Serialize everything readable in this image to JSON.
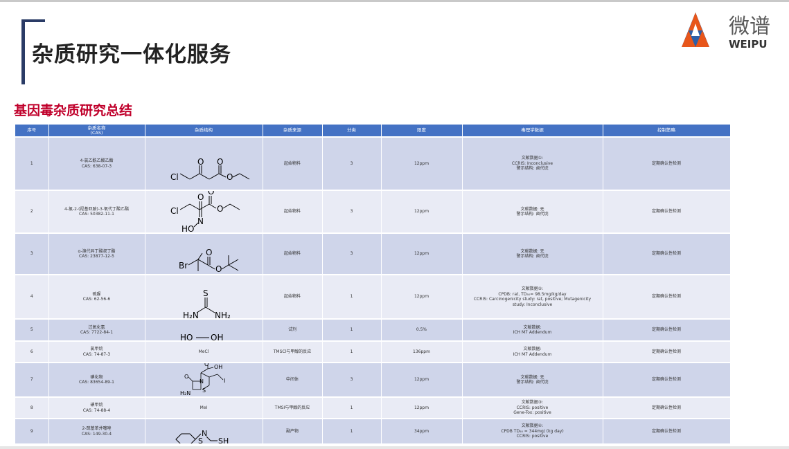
{
  "header": {
    "title": "杂质研究一体化服务"
  },
  "logo": {
    "name_cn": "微谱",
    "name_en": "WEIPU",
    "colors": {
      "blue": "#2d5fa8",
      "orange": "#e8561a"
    }
  },
  "section": {
    "title": "基因毒杂质研究总结"
  },
  "table": {
    "headers": [
      "序号",
      "杂质名称\n(CAS)",
      "杂质结构",
      "杂质来源",
      "分类",
      "限度",
      "毒理学数据",
      "控制策略"
    ],
    "rows": [
      {
        "no": "1",
        "name": "4-氯乙酰乙酸乙酯",
        "cas": "CAS: 638-07-3",
        "source": "起始物料",
        "class": "3",
        "limit": "12ppm",
        "tox": [
          "文献数据①:",
          "CCRIS: Inconclusive",
          "警示结构: 卤代烷"
        ],
        "control": "定期确认性检测"
      },
      {
        "no": "2",
        "name": "4-氯-2-(羟基亚胺)-3-氧代丁酸乙酯",
        "cas": "CAS: 50382-11-1",
        "source": "起始物料",
        "class": "3",
        "limit": "12ppm",
        "tox": [
          "文献数据: 无",
          "警示结构: 卤代烷"
        ],
        "control": "定期确认性检测"
      },
      {
        "no": "3",
        "name": "α-溴代异丁酸叔丁酯",
        "cas": "CAS: 23877-12-5",
        "source": "起始物料",
        "class": "3",
        "limit": "12ppm",
        "tox": [
          "文献数据: 无",
          "警示结构: 卤代烷"
        ],
        "control": "定期确认性检测"
      },
      {
        "no": "4",
        "name": "硫脲",
        "cas": "CAS: 62-56-6",
        "source": "起始物料",
        "class": "1",
        "limit": "12ppm",
        "tox": [
          "文献数据②:",
          "CPDB: rat, TD₅₀= 98.5mg/kg/day",
          "CCRIS: Carcinogenicity study: rat, positive; Mutagenicity",
          "study: Inconclusive"
        ],
        "control": "定期确认性检测"
      },
      {
        "no": "5",
        "name": "过氧化氢",
        "cas": "CAS: 7722-84-1",
        "source": "试剂",
        "class": "1",
        "limit": "0.5%",
        "tox": [
          "文献数据:",
          "ICH M7 Addendum"
        ],
        "control": "定期确认性检测"
      },
      {
        "no": "6",
        "name": "氯甲烷",
        "cas": "CAS: 74-87-3",
        "source": "TMSCl与甲醇的反应",
        "class": "1",
        "limit": "136ppm",
        "tox": [
          "文献数据:",
          "ICH M7 Addendum"
        ],
        "control": "定期确认性检测"
      },
      {
        "no": "7",
        "name": "碘化物",
        "cas": "CAS: 83654-89-1",
        "source": "中间体",
        "class": "3",
        "limit": "12ppm",
        "tox": [
          "文献数据: 无",
          "警示结构: 卤代烷"
        ],
        "control": "定期确认性检测"
      },
      {
        "no": "8",
        "name": "碘甲烷",
        "cas": "CAS: 74-88-4",
        "source": "TMSI与甲醇的反应",
        "class": "1",
        "limit": "12ppm",
        "tox": [
          "文献数据③:",
          "CCRIS: positive",
          "Gene-Tox: positive"
        ],
        "control": "定期确认性检测"
      },
      {
        "no": "9",
        "name": "2-巯基苯并噻唑",
        "cas": "CAS: 149-30-4",
        "source": "副产物",
        "class": "1",
        "limit": "34ppm",
        "tox": [
          "文献数据④:",
          "CPDB TD₅₀ = 344mg/ (kg day)",
          "CCRIS: positive"
        ],
        "control": "定期确认性检测"
      }
    ]
  },
  "structures": {
    "s1": {
      "atoms": [
        "Cl",
        "O",
        "O",
        "O"
      ]
    },
    "s2": {
      "atoms": [
        "Cl",
        "O",
        "O",
        "O",
        "N",
        "HO"
      ]
    },
    "s3": {
      "atoms": [
        "Br",
        "O",
        "O"
      ]
    },
    "s4": {
      "atoms": [
        "S",
        "H₂N",
        "NH₂"
      ]
    },
    "s5": {
      "atoms": [
        "HO",
        "OH"
      ]
    },
    "s6": {
      "label": "MeCl"
    },
    "s7": {
      "atoms": [
        "O",
        "OH",
        "O",
        "N",
        "S",
        "I",
        "H₂N"
      ]
    },
    "s8": {
      "label": "MeI"
    },
    "s9": {
      "atoms": [
        "N",
        "S",
        "SH"
      ]
    }
  }
}
